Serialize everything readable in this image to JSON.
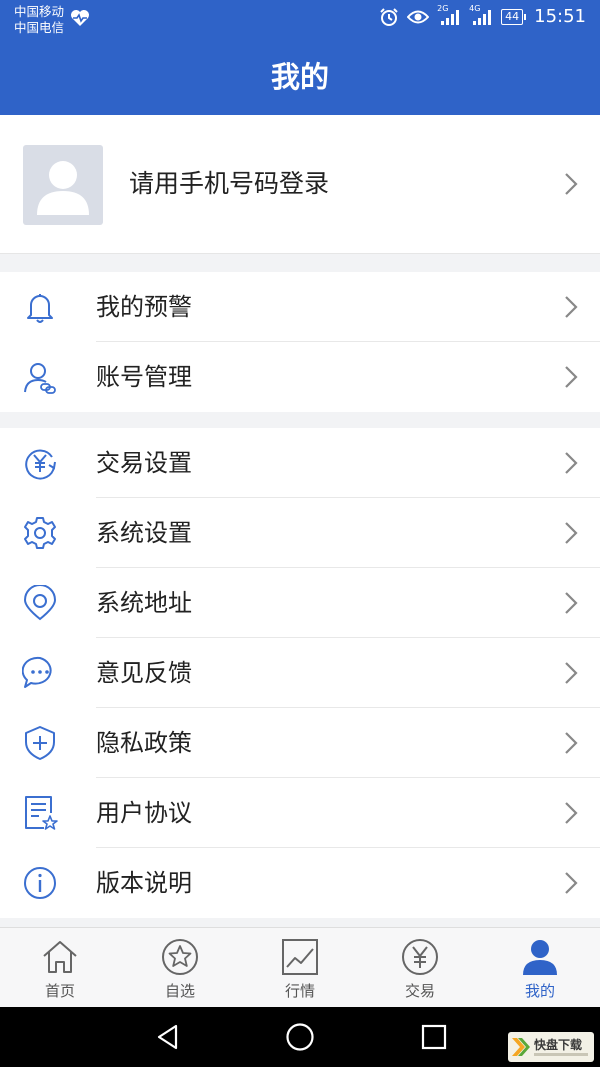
{
  "status": {
    "carrier1": "中国移动",
    "carrier2": "中国电信",
    "net1": "2G",
    "net2": "4G",
    "battery": "44",
    "time": "15:51"
  },
  "header": {
    "title": "我的"
  },
  "profile": {
    "login_text": "请用手机号码登录"
  },
  "menu_group1": [
    {
      "label": "我的预警",
      "icon": "bell-icon"
    },
    {
      "label": "账号管理",
      "icon": "user-link-icon"
    }
  ],
  "menu_group2": [
    {
      "label": "交易设置",
      "icon": "yen-refresh-icon"
    },
    {
      "label": "系统设置",
      "icon": "gear-icon"
    },
    {
      "label": "系统地址",
      "icon": "location-icon"
    },
    {
      "label": "意见反馈",
      "icon": "chat-icon"
    },
    {
      "label": "隐私政策",
      "icon": "shield-plus-icon"
    },
    {
      "label": "用户协议",
      "icon": "document-star-icon"
    },
    {
      "label": "版本说明",
      "icon": "info-icon"
    }
  ],
  "tabbar": [
    {
      "label": "首页",
      "icon": "home-icon",
      "active": false
    },
    {
      "label": "自选",
      "icon": "star-circle-icon",
      "active": false
    },
    {
      "label": "行情",
      "icon": "chart-line-icon",
      "active": false
    },
    {
      "label": "交易",
      "icon": "yen-circle-icon",
      "active": false
    },
    {
      "label": "我的",
      "icon": "person-icon",
      "active": true
    }
  ],
  "colors": {
    "primary": "#2f63c8",
    "icon_blue": "#3b6fd0",
    "background": "#f2f3f5"
  },
  "watermark": {
    "brand": "快盘下载"
  }
}
